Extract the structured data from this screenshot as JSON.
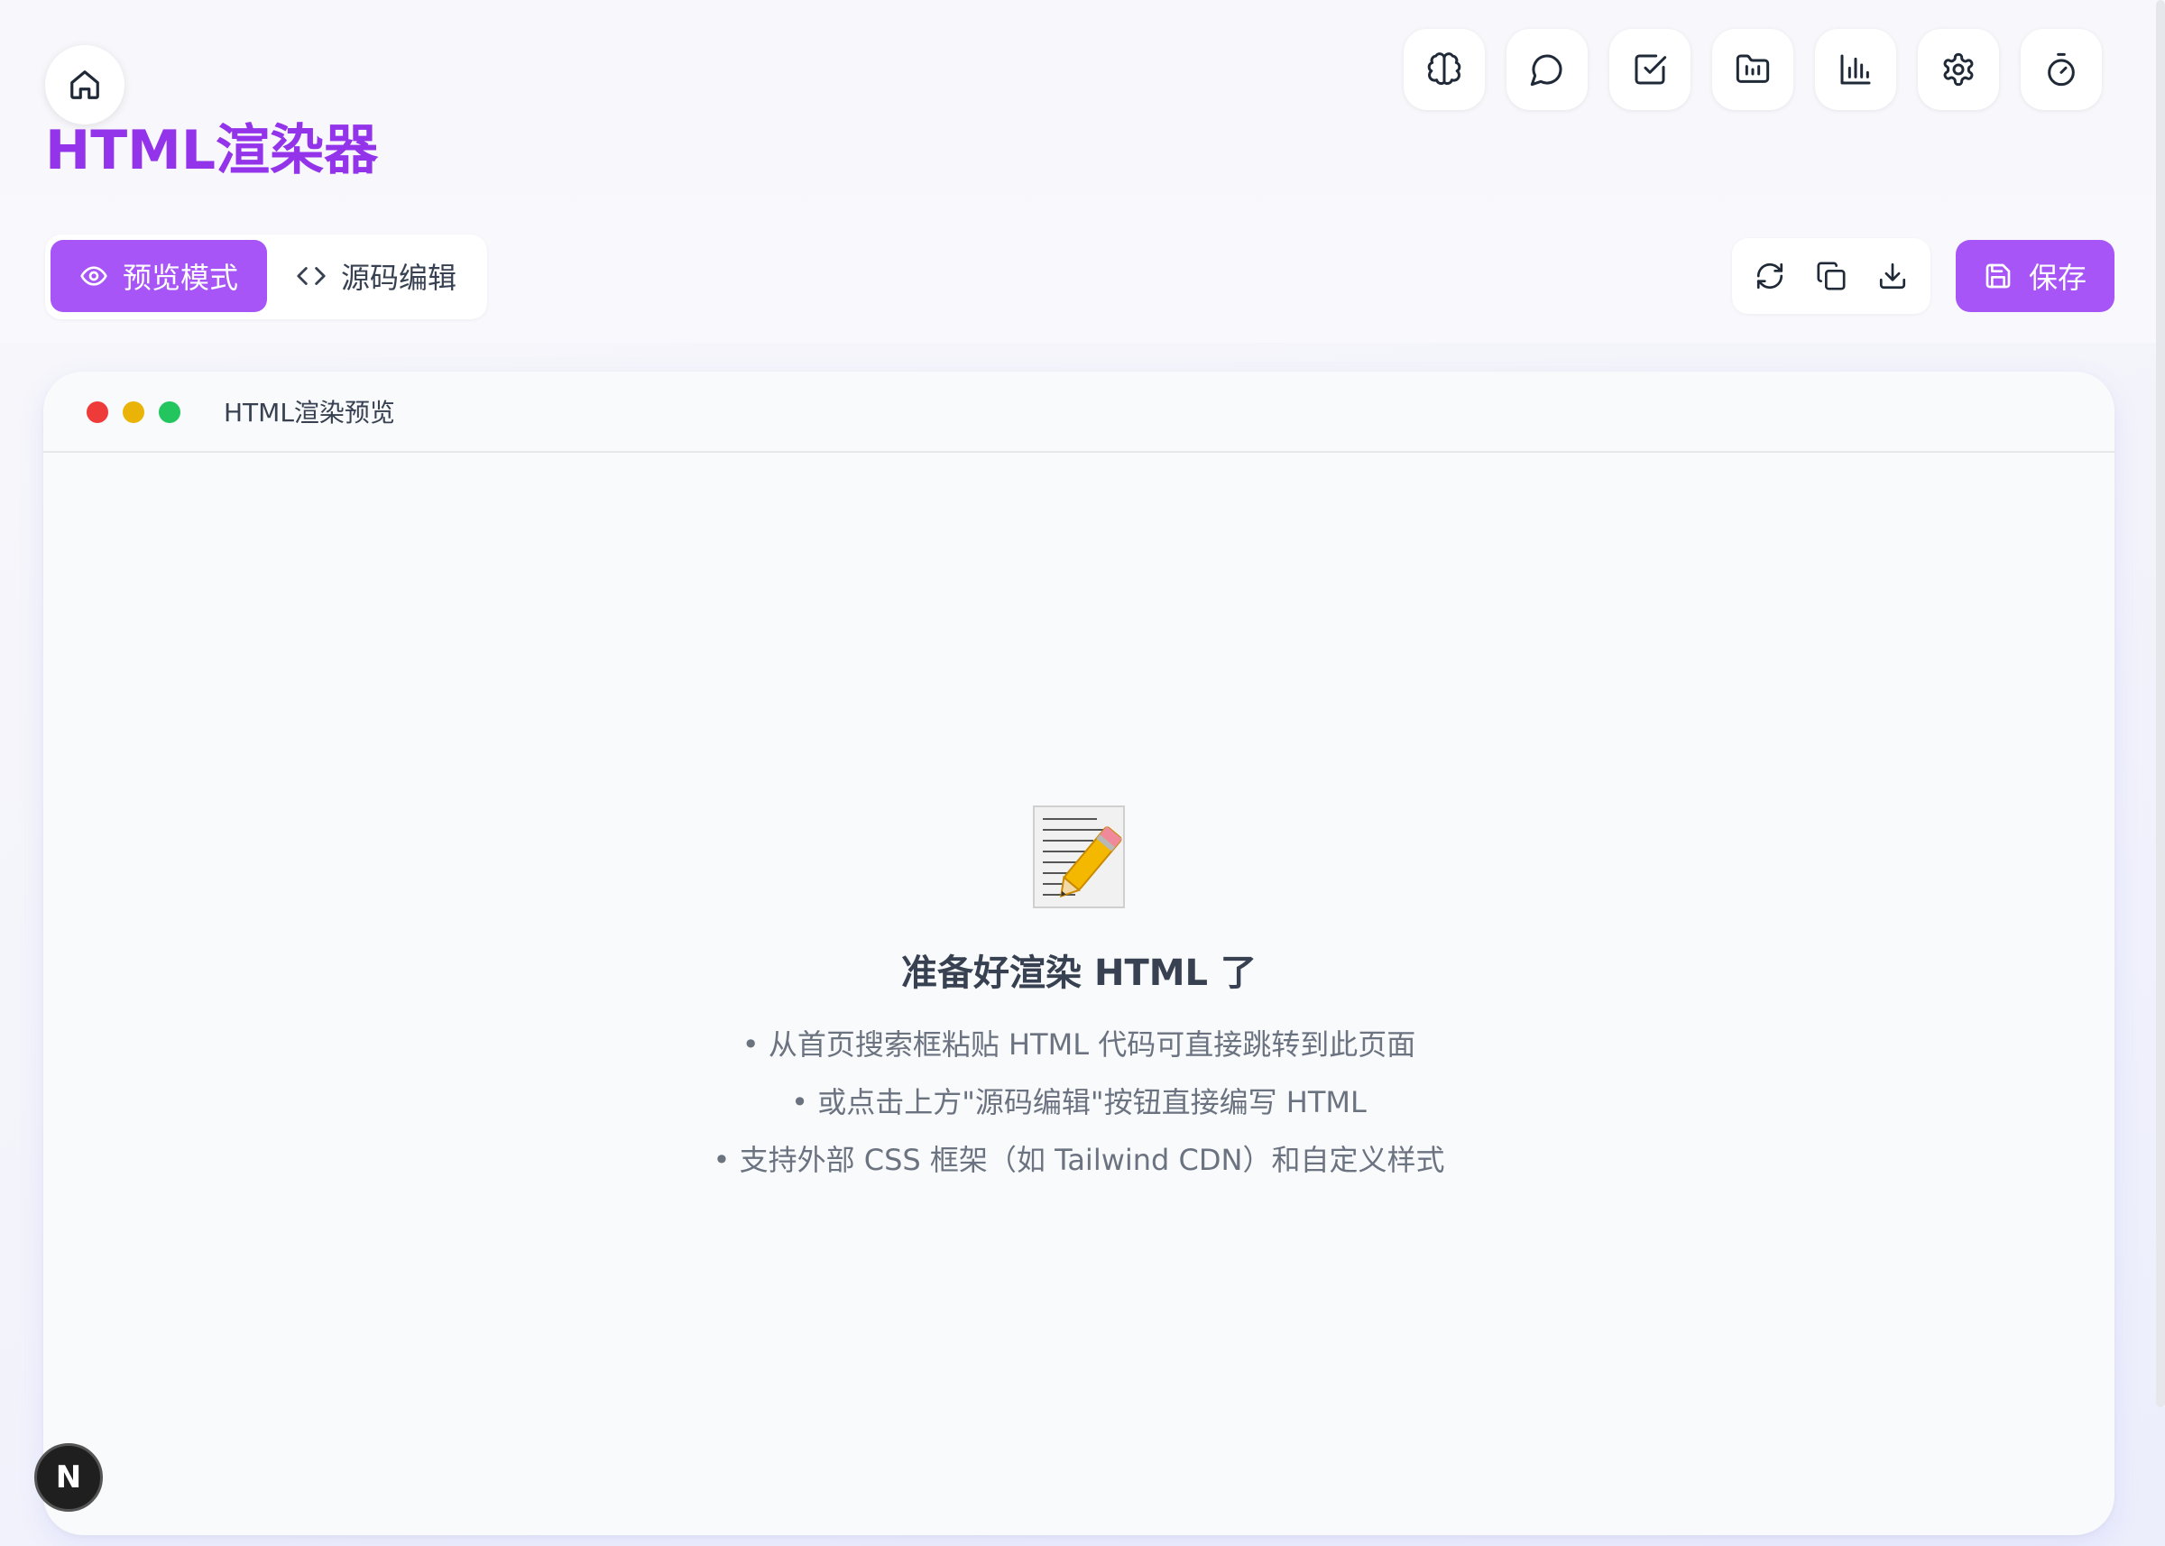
{
  "app": {
    "title": "HTML渲染器"
  },
  "nav": {
    "home_icon": "home-icon",
    "icons": [
      "brain-icon",
      "chat-bubble-icon",
      "checkbox-icon",
      "folder-chart-icon",
      "bar-chart-icon",
      "gear-icon",
      "timer-icon"
    ]
  },
  "toolbar": {
    "preview_label": "预览模式",
    "source_label": "源码编辑",
    "save_label": "保存",
    "action_icons": [
      "refresh-icon",
      "copy-icon",
      "download-icon"
    ]
  },
  "preview": {
    "window_title": "HTML渲染预览",
    "empty_title": "准备好渲染 HTML 了",
    "tips": [
      "• 从首页搜索框粘贴 HTML 代码可直接跳转到此页面",
      "• 或点击上方\"源码编辑\"按钮直接编写 HTML",
      "• 支持外部 CSS 框架（如 Tailwind CDN）和自定义样式"
    ]
  },
  "badge": {
    "label": "N"
  },
  "colors": {
    "accent": "#a855f7",
    "title": "#9333ea"
  }
}
